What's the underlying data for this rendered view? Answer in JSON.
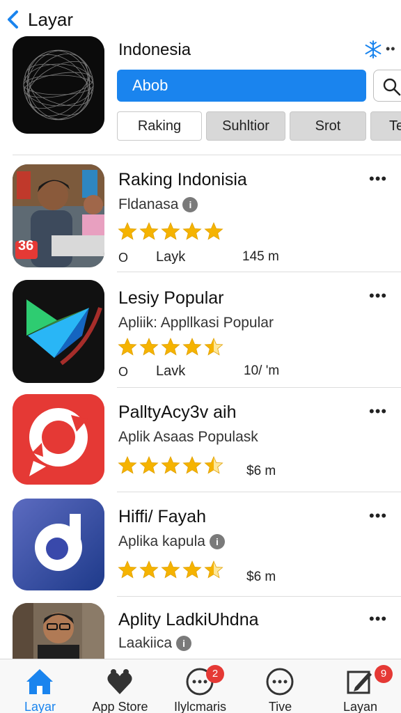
{
  "header": {
    "back_label": "Layar"
  },
  "featured": {
    "title": "Indonesia",
    "primary_button": "Abob",
    "segments": [
      "Raking",
      "Suhltior",
      "Srot",
      "Te"
    ]
  },
  "apps": [
    {
      "title": "Raking Indonisia",
      "subtitle": "Fldanasa",
      "rating": 5,
      "status": "O",
      "action": "Layk",
      "size": "145 m",
      "more": "•••",
      "badge_text": "36"
    },
    {
      "title": "Lesiy Popular",
      "subtitle": "Apliik: Appllkasi Popular",
      "rating": 4.5,
      "status": "O",
      "action": "Lavk",
      "size": "10/ 'm",
      "more": "•••"
    },
    {
      "title": "PalltyAcy3v aih",
      "subtitle": "Aplik Asaas Populask",
      "rating": 4.5,
      "size": "$6 m",
      "more": "•••"
    },
    {
      "title": "Hiffi/ Fayah",
      "subtitle": "Aplika kapula",
      "rating": 4.5,
      "size": "$6 m",
      "more": "•••"
    },
    {
      "title": "Aplity LadkiUhdna",
      "subtitle": "Laakiica",
      "more": "•••"
    }
  ],
  "tabbar": {
    "tabs": [
      {
        "label": "Layar",
        "icon": "home-icon",
        "active": true
      },
      {
        "label": "App Store",
        "icon": "heart-hands-icon"
      },
      {
        "label": "Ilylcmaris",
        "icon": "chat-bubble-icon",
        "badge": "2"
      },
      {
        "label": "Tive",
        "icon": "chat-bubble-icon"
      },
      {
        "label": "Layan",
        "icon": "edit-icon",
        "badge": "9"
      }
    ]
  },
  "colors": {
    "accent": "#1a84ee",
    "star": "#f5b301",
    "badge": "#e53935"
  }
}
